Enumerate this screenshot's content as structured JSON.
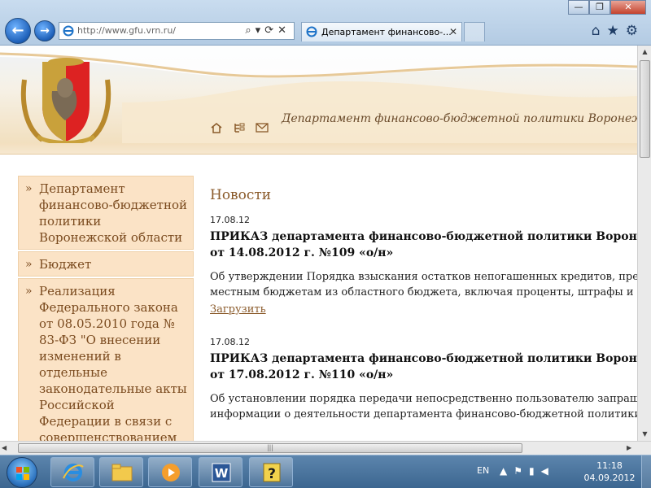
{
  "browser": {
    "address_url": "http://www.gfu.vrn.ru/",
    "tab_title": "Департамент финансово-...",
    "tab_close": "✕",
    "window_controls": {
      "minimize": "—",
      "maximize": "❐",
      "close": "✕"
    },
    "toolbar_icons": "⌂★⚙",
    "back_label": "←",
    "forward_label": "→",
    "address_tools": "⌕▾⟳✕"
  },
  "site": {
    "title": "Департамент финансово-бюджетной политики Воронежской области"
  },
  "sidebar": {
    "bullet": "»",
    "items": [
      {
        "label": "Департамент финансово-бюджетной политики Воронежской области"
      },
      {
        "label": "Бюджет"
      },
      {
        "label": "Реализация Федерального закона от 08.05.2010 года № 83-ФЗ \"О внесении изменений в отдельные законодательные акты Российской Федерации в связи с совершенствованием"
      }
    ]
  },
  "main": {
    "heading": "Новости",
    "news": [
      {
        "date": "17.08.12",
        "title_line1": "ПРИКАЗ департамента финансово-бюджетной политики Воронежской области",
        "title_line2": "от 14.08.2012 г. №109 «о/н»",
        "excerpt_line1": "Об утверждении Порядка взыскания остатков непогашенных кредитов, предоставленных",
        "excerpt_line2": "местным бюджетам из областного бюджета, включая проценты, штрафы и пени",
        "download": "Загрузить"
      },
      {
        "date": "17.08.12",
        "title_line1": "ПРИКАЗ департамента финансово-бюджетной политики Воронежской области",
        "title_line2": "от 17.08.2012 г. №110 «о/н»",
        "excerpt_line1": "Об установлении порядка передачи непосредственно пользователю запрашиваемой",
        "excerpt_line2": "информации о деятельности департамента финансово-бюджетной политики"
      }
    ]
  },
  "taskbar": {
    "language": "EN",
    "time": "11:18",
    "date": "04.09.2012",
    "tray_icons": "▲⚑▮◀"
  }
}
